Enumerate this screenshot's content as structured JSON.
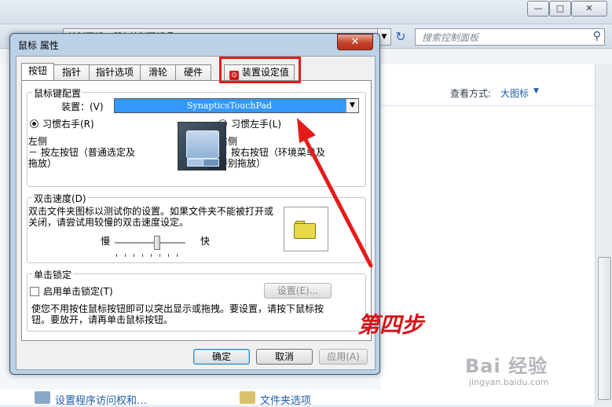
{
  "background_window": {
    "breadcrumb": "控制面板  ▸  所有控制面板项  ▸",
    "search_placeholder": "搜索控制面板",
    "view_mode_label": "查看方式:",
    "view_mode_value": "大图标",
    "caption_buttons": {
      "minimize": "—",
      "maximize": "□",
      "close": "✕"
    },
    "bottom_item_1": "设置程序访问权和…",
    "bottom_item_2": "文件夹选项"
  },
  "dialog": {
    "title": "鼠标 属性",
    "close": "✕",
    "tabs": [
      {
        "label": "按钮",
        "active": true
      },
      {
        "label": "指针"
      },
      {
        "label": "指针选项"
      },
      {
        "label": "滑轮"
      },
      {
        "label": "硬件"
      },
      {
        "label": "装置设定值"
      }
    ],
    "button_config": {
      "group_label": "鼠标键配置",
      "device_label": "装置：(V)",
      "device_value": "SynapticsTouchPad",
      "right_hand": "习惯右手(R)",
      "left_hand": "习惯左手(L)",
      "left_side_title": "左侧",
      "left_side_line1": "－ 按左按钮（普通选定及",
      "left_side_line2": "拖放）",
      "right_side_title": "右侧",
      "right_side_line1": "－ 按右按钮（环境菜单及",
      "right_side_line2": "特别拖放）"
    },
    "double_click": {
      "group_label": "双击速度(D)",
      "line1": "双击文件夹图标以测试你的设置。如果文件夹不能被打开或",
      "line2": "关闭，请尝试用较慢的双击速度设定。",
      "slow": "慢",
      "fast": "快",
      "speed_level": 0.6
    },
    "click_lock": {
      "group_label": "单击锁定",
      "checkbox_label": "启用单击锁定(T)",
      "settings_button": "设置(E)...",
      "desc_line1": "使您不用按住鼠标按钮即可以突出显示或拖拽。要设置，请按下鼠标按",
      "desc_line2": "钮。要放开，请再单击鼠标按钮。"
    },
    "buttons": {
      "ok": "确定",
      "cancel": "取消",
      "apply": "应用(A)"
    }
  },
  "annotation": {
    "step_text": "第四步",
    "color": "#e51b1b"
  },
  "watermark": {
    "brand": "Bai 经验",
    "url": "jingyan.baidu.com"
  }
}
